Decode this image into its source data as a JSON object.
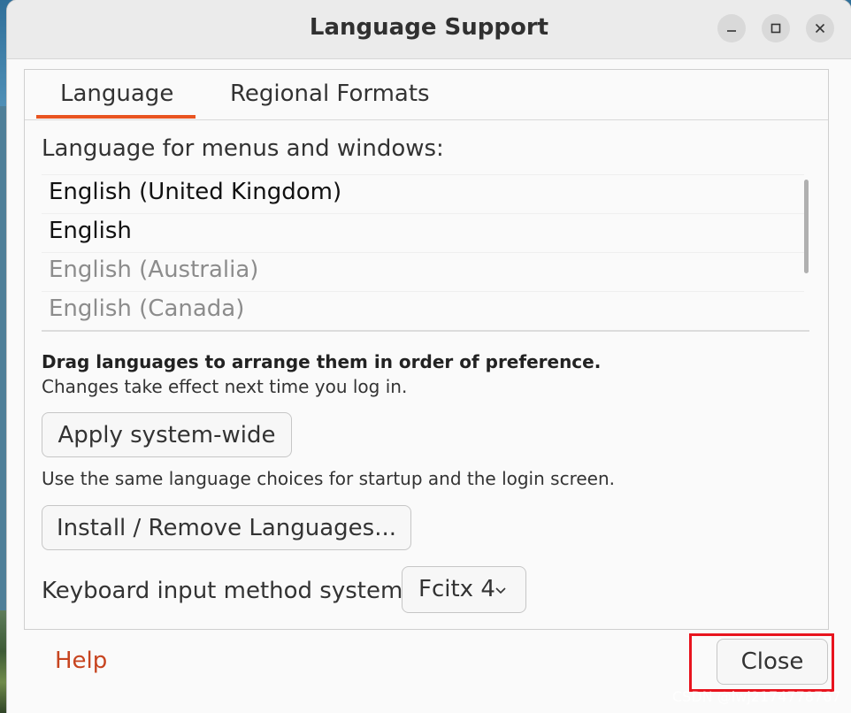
{
  "window": {
    "title": "Language Support"
  },
  "tabs": [
    {
      "label": "Language"
    },
    {
      "label": "Regional Formats"
    }
  ],
  "language_tab": {
    "menus_label": "Language for menus and windows:",
    "languages": [
      {
        "label": "English (United Kingdom)",
        "state": "active"
      },
      {
        "label": "English",
        "state": "active"
      },
      {
        "label": "English (Australia)",
        "state": "inactive"
      },
      {
        "label": "English (Canada)",
        "state": "inactive"
      }
    ],
    "drag_hint": "Drag languages to arrange them in order of preference.",
    "changes_note": "Changes take effect next time you log in.",
    "apply_button": "Apply system-wide",
    "apply_note": "Use the same language choices for startup and the login screen.",
    "install_button": "Install / Remove Languages...",
    "keyboard_label": "Keyboard input method system:",
    "keyboard_value": "Fcitx 4"
  },
  "footer": {
    "help_label": "Help",
    "close_label": "Close"
  },
  "watermark": "CSDN @lwj2174778767",
  "colors": {
    "accent": "#e95420",
    "link": "#c7441f",
    "highlight_box": "#e8141e"
  }
}
